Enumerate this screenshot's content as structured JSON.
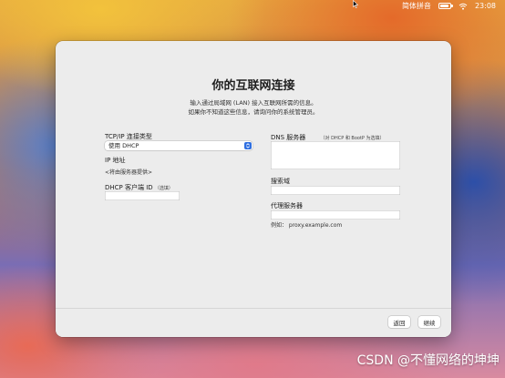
{
  "menubar": {
    "input_source": "简体拼音",
    "time": "23:08"
  },
  "dialog": {
    "title": "你的互联网连接",
    "description_line1": "输入通过局域网 (LAN) 接入互联网所需的信息。",
    "description_line2": "如果你不知道这些信息，请询问你的系统管理员。"
  },
  "left": {
    "tcpip_label": "TCP/IP 连接类型",
    "tcpip_value": "使用 DHCP",
    "ip_label": "IP 地址",
    "ip_value": "<将由服务器提供>",
    "dhcp_id_label": "DHCP 客户端 ID",
    "dhcp_id_optional": "（选填）",
    "dhcp_id_value": ""
  },
  "right": {
    "dns_label": "DNS 服务器",
    "dns_note": "（对 DHCP 和 BootP 为选填）",
    "dns_value": "",
    "search_label": "搜索域",
    "search_value": "",
    "proxy_label": "代理服务器",
    "proxy_value": "",
    "proxy_example": "例如： proxy.example.com"
  },
  "footer": {
    "back_label": "返回",
    "continue_label": "继续"
  },
  "watermark": "CSDN @不懂网络的坤坤",
  "colors": {
    "accent": "#2f6fe0",
    "window_bg": "#ececec"
  }
}
